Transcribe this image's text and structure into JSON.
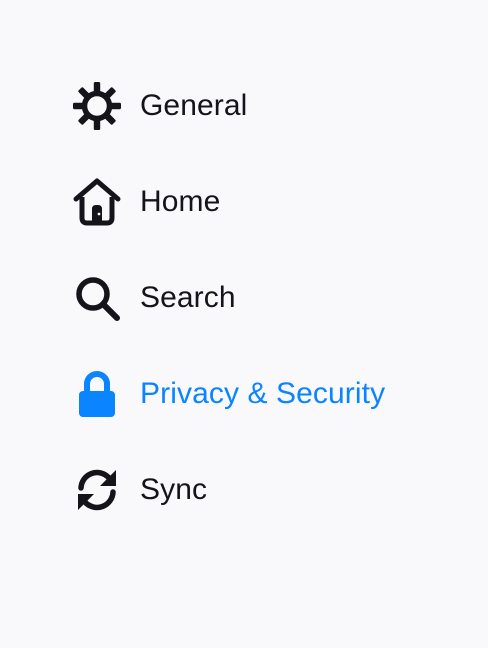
{
  "sidebar": {
    "items": [
      {
        "label": "General",
        "icon": "gear-icon",
        "selected": false
      },
      {
        "label": "Home",
        "icon": "home-icon",
        "selected": false
      },
      {
        "label": "Search",
        "icon": "search-icon",
        "selected": false
      },
      {
        "label": "Privacy & Security",
        "icon": "lock-icon",
        "selected": true
      },
      {
        "label": "Sync",
        "icon": "sync-icon",
        "selected": false
      }
    ]
  },
  "colors": {
    "background": "#f9f9fb",
    "text": "#15141a",
    "accent": "#0a84ff"
  }
}
